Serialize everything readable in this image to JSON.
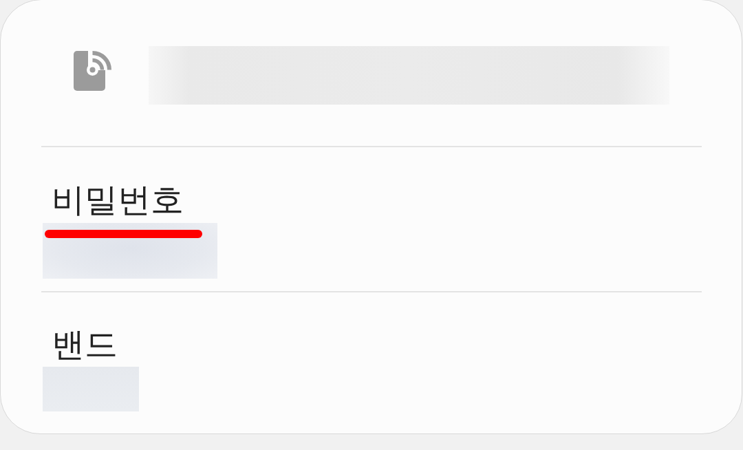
{
  "network": {
    "redacted": true
  },
  "fields": [
    {
      "label": "비밀번호",
      "redacted": true,
      "highlighted": true
    },
    {
      "label": "밴드",
      "redacted": true,
      "highlighted": false
    }
  ]
}
